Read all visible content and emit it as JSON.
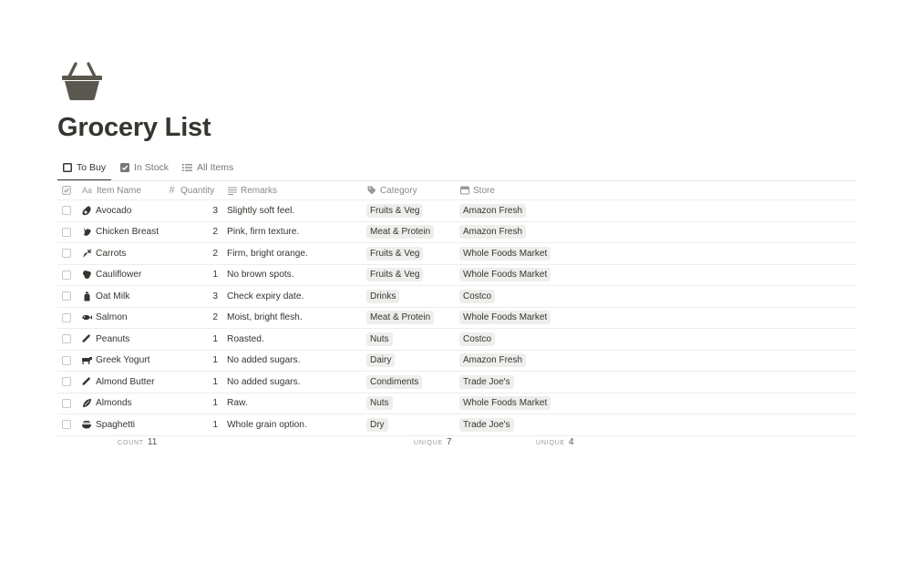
{
  "page": {
    "title": "Grocery List",
    "icon": "basket-icon"
  },
  "views": [
    {
      "label": "To Buy",
      "icon": "checkbox-empty-icon",
      "active": true
    },
    {
      "label": "In Stock",
      "icon": "checkbox-checked-icon",
      "active": false
    },
    {
      "label": "All Items",
      "icon": "list-icon",
      "active": false
    }
  ],
  "columns": {
    "check": {
      "icon": "checkbox-header-icon"
    },
    "name": {
      "label": "Item Name",
      "icon": "text-aa-icon"
    },
    "quantity": {
      "label": "Quantity",
      "icon": "hash-icon"
    },
    "remarks": {
      "label": "Remarks",
      "icon": "text-lines-icon"
    },
    "category": {
      "label": "Category",
      "icon": "tag-icon"
    },
    "store": {
      "label": "Store",
      "icon": "store-icon"
    }
  },
  "rows": [
    {
      "name": "Avocado",
      "icon": "avocado-icon",
      "quantity": "3",
      "remarks": "Slightly soft feel.",
      "category": "Fruits & Veg",
      "store": "Amazon Fresh"
    },
    {
      "name": "Chicken Breast",
      "icon": "chicken-icon",
      "quantity": "2",
      "remarks": "Pink, firm texture.",
      "category": "Meat & Protein",
      "store": "Amazon Fresh"
    },
    {
      "name": "Carrots",
      "icon": "carrot-icon",
      "quantity": "2",
      "remarks": "Firm, bright orange.",
      "category": "Fruits & Veg",
      "store": "Whole Foods Market"
    },
    {
      "name": "Cauliflower",
      "icon": "cauliflower-icon",
      "quantity": "1",
      "remarks": "No brown spots.",
      "category": "Fruits & Veg",
      "store": "Whole Foods Market"
    },
    {
      "name": "Oat Milk",
      "icon": "milk-icon",
      "quantity": "3",
      "remarks": "Check expiry date.",
      "category": "Drinks",
      "store": "Costco"
    },
    {
      "name": "Salmon",
      "icon": "fish-icon",
      "quantity": "2",
      "remarks": "Moist, bright flesh.",
      "category": "Meat & Protein",
      "store": "Whole Foods Market"
    },
    {
      "name": "Peanuts",
      "icon": "peanut-icon",
      "quantity": "1",
      "remarks": "Roasted.",
      "category": "Nuts",
      "store": "Costco"
    },
    {
      "name": "Greek Yogurt",
      "icon": "cow-icon",
      "quantity": "1",
      "remarks": "No added sugars.",
      "category": "Dairy",
      "store": "Amazon Fresh"
    },
    {
      "name": "Almond Butter",
      "icon": "peanut-icon",
      "quantity": "1",
      "remarks": "No added sugars.",
      "category": "Condiments",
      "store": "Trade Joe's"
    },
    {
      "name": "Almonds",
      "icon": "almond-icon",
      "quantity": "1",
      "remarks": "Raw.",
      "category": "Nuts",
      "store": "Whole Foods Market"
    },
    {
      "name": "Spaghetti",
      "icon": "pasta-icon",
      "quantity": "1",
      "remarks": "Whole grain option.",
      "category": "Dry",
      "store": "Trade Joe's"
    }
  ],
  "footer": {
    "count": {
      "key": "COUNT",
      "value": "11"
    },
    "category_unique": {
      "key": "UNIQUE",
      "value": "7"
    },
    "store_unique": {
      "key": "UNIQUE",
      "value": "4"
    }
  },
  "colors": {
    "text": "#37352f",
    "muted": "#787774",
    "tag_bg": "#eeeeec",
    "border": "#ededeb",
    "icon": "#5a574f"
  }
}
